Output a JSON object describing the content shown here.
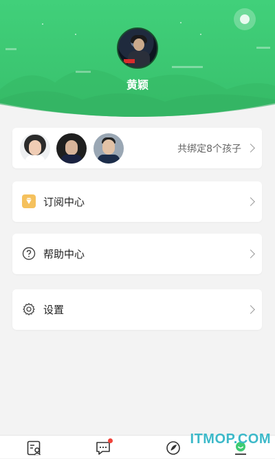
{
  "profile": {
    "username": "黄颖"
  },
  "kids": {
    "count_text": "共绑定8个孩子"
  },
  "menu": {
    "subscription": "订阅中心",
    "help": "帮助中心",
    "settings": "设置"
  },
  "watermark": "ITMOP.COM",
  "colors": {
    "brand_green": "#3fcb73",
    "badge_orange": "#f5c15d",
    "notification_red": "#f0433a"
  },
  "tabbar": {
    "items": [
      {
        "icon": "profile-card-icon"
      },
      {
        "icon": "chat-bubble-icon",
        "has_dot": true
      },
      {
        "icon": "compass-icon"
      },
      {
        "icon": "me-icon",
        "active": true
      }
    ]
  }
}
